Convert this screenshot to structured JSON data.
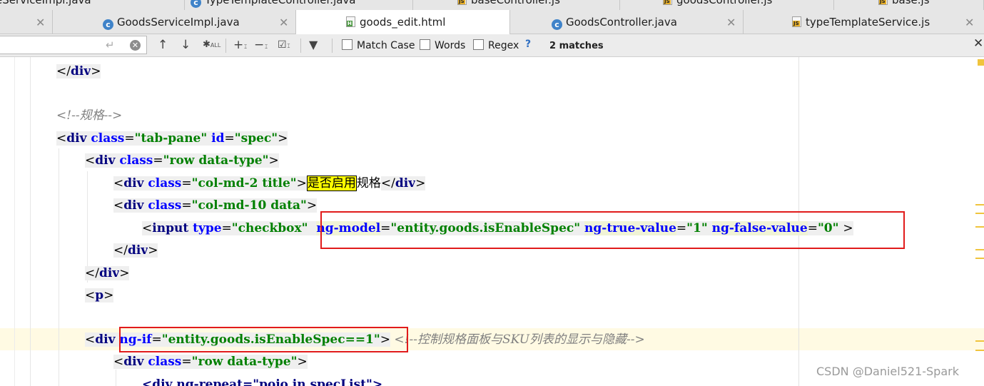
{
  "tabs_top": [
    {
      "label": "eServiceImpl.java",
      "icon": "class-icon"
    },
    {
      "label": "TypeTemplateController.java",
      "icon": "class-icon"
    },
    {
      "label": "baseController.js",
      "icon": "js-icon"
    },
    {
      "label": "goodsController.js",
      "icon": "js-icon"
    },
    {
      "label": "base.js",
      "icon": "js-icon"
    }
  ],
  "tabs": [
    {
      "label": "GoodsServiceImpl.java",
      "icon": "class-icon",
      "active": false
    },
    {
      "label": "goods_edit.html",
      "icon": "html-icon",
      "active": true
    },
    {
      "label": "GoodsController.java",
      "icon": "class-icon",
      "active": false
    },
    {
      "label": "typeTemplateService.js",
      "icon": "js-icon",
      "active": false
    }
  ],
  "search": {
    "query": "",
    "options": {
      "match_case": "Match Case",
      "words": "Words",
      "regex": "Regex",
      "help": "?"
    },
    "result_count": "2 matches",
    "close": "✕"
  },
  "code": {
    "l1_close_div": "div",
    "l2_comment": "<!--规格-->",
    "l3_tag": "div",
    "l3_a1": "class",
    "l3_v1": "\"tab-pane\"",
    "l3_a2": "id",
    "l3_v2": "\"spec\"",
    "l4_tag": "div",
    "l4_a1": "class",
    "l4_v1": "\"row data-type\"",
    "l5_tag": "div",
    "l5_a1": "class",
    "l5_v1": "\"col-md-2 title\"",
    "l5_text_match": "是否启用",
    "l5_text_rest": "规格",
    "l5_close": "div",
    "l6_tag": "div",
    "l6_a1": "class",
    "l6_v1": "\"col-md-10 data\"",
    "l7_tag": "input",
    "l7_a1": "type",
    "l7_v1": "\"checkbox\"",
    "l7_a2": "ng-model",
    "l7_v2": "\"entity.goods.isEnableSpec\"",
    "l7_a3": "ng-true-value",
    "l7_v3": "\"1\"",
    "l7_a4": "ng-false-value",
    "l7_v4": "\"0\"",
    "l8_close": "div",
    "l9_close": "div",
    "l10_tag": "p",
    "l12_tag": "div",
    "l12_a1": "ng-if",
    "l12_v1": "\"entity.goods.isEnableSpec==1\"",
    "l12_comment": "<!--控制规格面板与SKU列表的显示与隐藏-->",
    "l13_tag": "div",
    "l13_a1": "class",
    "l13_v1": "\"row data-type\"",
    "l14_partial": "<div ng-repeat=\"pojo in specList\">"
  },
  "colors": {
    "tag": "#00007f",
    "attribute": "#0000ff",
    "value": "#008000",
    "comment": "#808080",
    "annotation_box": "#e11b1b",
    "search_highlight": "#ffff00"
  },
  "watermark": "CSDN @Daniel521-Spark"
}
